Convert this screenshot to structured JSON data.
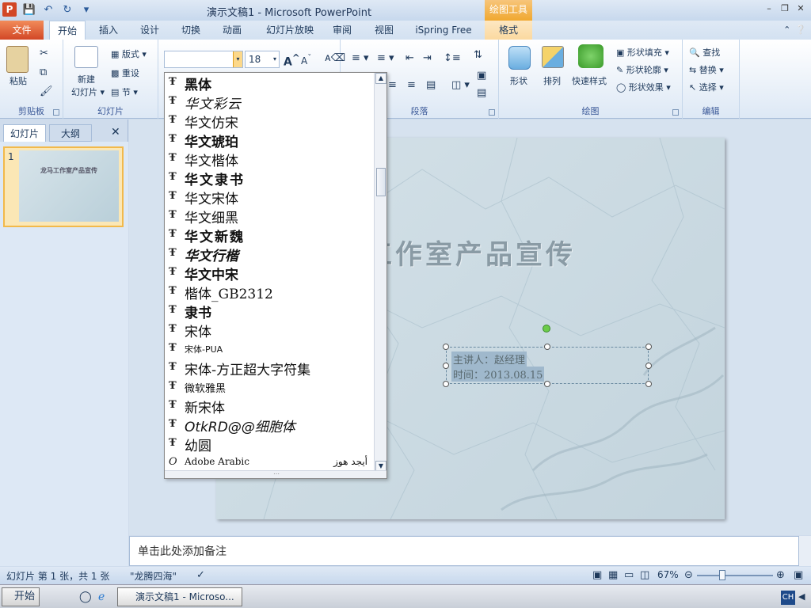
{
  "window": {
    "app_icon": "P",
    "title": "演示文稿1 - Microsoft PowerPoint",
    "context_tool": "绘图工具"
  },
  "tabs": [
    "文件",
    "开始",
    "插入",
    "设计",
    "切换",
    "动画",
    "幻灯片放映",
    "审阅",
    "视图",
    "iSpring Free",
    "格式"
  ],
  "ribbon": {
    "clipboard": {
      "paste": "粘贴",
      "label": "剪贴板"
    },
    "slides": {
      "new_slide": "新建",
      "new_slide2": "幻灯片",
      "layout": "版式",
      "reset": "重设",
      "section": "节",
      "label": "幻灯片"
    },
    "font": {
      "font_name": "",
      "font_size": "18"
    },
    "paragraph": {
      "label": "段落"
    },
    "drawing": {
      "shape": "形状",
      "arrange": "排列",
      "quick_styles": "快速样式",
      "shape_fill": "形状填充",
      "shape_outline": "形状轮廓",
      "shape_effects": "形状效果",
      "label": "绘图"
    },
    "editing": {
      "find": "查找",
      "replace": "替换",
      "select": "选择",
      "label": "编辑"
    }
  },
  "left_panel": {
    "tab_slides": "幻灯片",
    "tab_outline": "大纲",
    "close": "✕",
    "slide_number": "1",
    "thumb_title": "龙马工作室产品宣传"
  },
  "slide": {
    "title": "工作室产品宣传",
    "line1": "主讲人：赵经理",
    "line2": "时间：2013.08.15"
  },
  "notes": {
    "placeholder": "单击此处添加备注"
  },
  "status": {
    "slide_info": "幻灯片 第 1 张，共 1 张",
    "theme": "\"龙腾四海\"",
    "zoom": "67%"
  },
  "taskbar": {
    "start": "开始",
    "task": "演示文稿1 - Microso...",
    "ime": "CH"
  },
  "font_list": [
    {
      "name": "黑体",
      "type": "T"
    },
    {
      "name": "华文彩云",
      "type": "T"
    },
    {
      "name": "华文仿宋",
      "type": "T"
    },
    {
      "name": "华文琥珀",
      "type": "T"
    },
    {
      "name": "华文楷体",
      "type": "T"
    },
    {
      "name": "华文隶书",
      "type": "T"
    },
    {
      "name": "华文宋体",
      "type": "T"
    },
    {
      "name": "华文细黑",
      "type": "T"
    },
    {
      "name": "华文新魏",
      "type": "T"
    },
    {
      "name": "华文行楷",
      "type": "T"
    },
    {
      "name": "华文中宋",
      "type": "T"
    },
    {
      "name": "楷体_GB2312",
      "type": "T"
    },
    {
      "name": "隶书",
      "type": "T"
    },
    {
      "name": "宋体",
      "type": "T"
    },
    {
      "name": "宋体-PUA",
      "type": "T"
    },
    {
      "name": "宋体-方正超大字符集",
      "type": "T"
    },
    {
      "name": "微软雅黑",
      "type": "T"
    },
    {
      "name": "新宋体",
      "type": "T"
    },
    {
      "name": "OtkRD@@细胞体",
      "type": "T"
    },
    {
      "name": "幼圆",
      "type": "T"
    },
    {
      "name": "Adobe Arabic",
      "type": "O",
      "sample": "أيجد هوز"
    }
  ]
}
